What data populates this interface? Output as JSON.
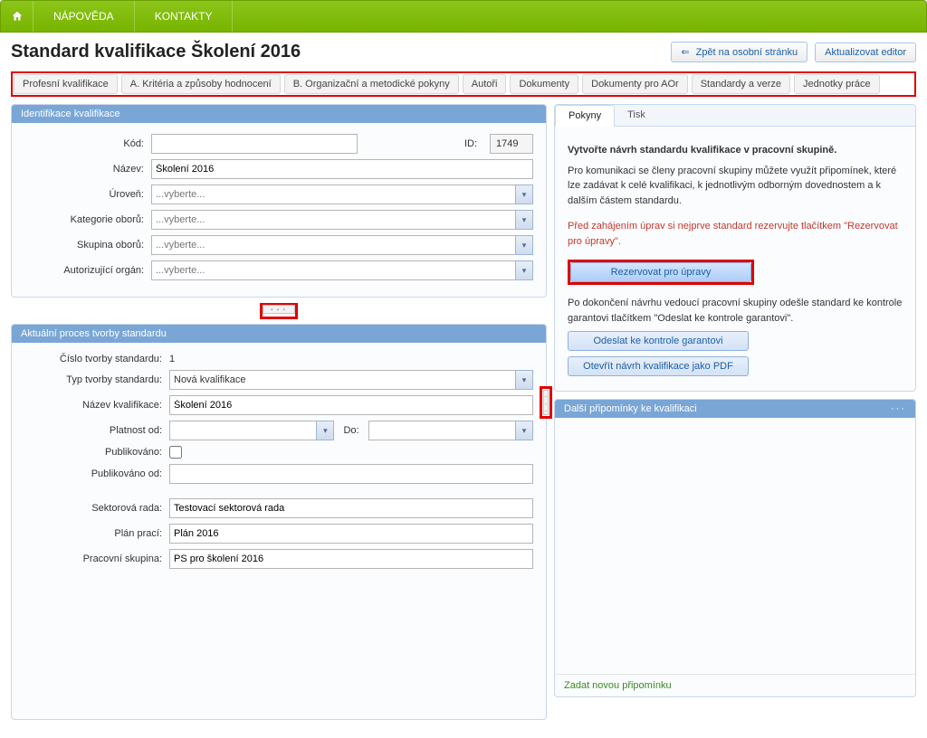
{
  "nav": {
    "help": "NÁPOVĚDA",
    "contacts": "KONTAKTY"
  },
  "header": {
    "title": "Standard kvalifikace Školení 2016",
    "back_btn": "Zpět na osobní stránku",
    "update_btn": "Aktualizovat editor"
  },
  "tabs": [
    "Profesní kvalifikace",
    "A. Kritéria a způsoby hodnocení",
    "B. Organizační a metodické pokyny",
    "Autoři",
    "Dokumenty",
    "Dokumenty pro AOr",
    "Standardy a verze",
    "Jednotky práce"
  ],
  "ident": {
    "title": "Identifikace kvalifikace",
    "labels": {
      "kod": "Kód:",
      "id": "ID:",
      "nazev": "Název:",
      "uroven": "Úroveň:",
      "kategorie": "Kategorie oborů:",
      "skupina": "Skupina oborů:",
      "autorg": "Autorizující orgán:"
    },
    "values": {
      "kod": "",
      "id": "1749",
      "nazev": "Školení 2016",
      "uroven": "...vyberte...",
      "kategorie": "...vyberte...",
      "skupina": "...vyberte...",
      "autorg": "...vyberte..."
    }
  },
  "process": {
    "title": "Aktuální proces tvorby standardu",
    "labels": {
      "cislo": "Číslo tvorby standardu:",
      "typ": "Typ tvorby standardu:",
      "nazev_kval": "Název kvalifikace:",
      "platnost_od": "Platnost od:",
      "do": "Do:",
      "publikovano": "Publikováno:",
      "publikovano_od": "Publikováno od:",
      "sektor": "Sektorová rada:",
      "plan": "Plán prací:",
      "skupina": "Pracovní skupina:"
    },
    "values": {
      "cislo": "1",
      "typ": "Nová kvalifikace",
      "nazev_kval": "Školení 2016",
      "platnost_od": "",
      "do": "",
      "publikovano": false,
      "publikovano_od": "",
      "sektor": "Testovací sektorová rada",
      "plan": "Plán 2016",
      "skupina": "PS pro školení 2016"
    }
  },
  "side": {
    "tabs": {
      "pokyny": "Pokyny",
      "tisk": "Tisk"
    },
    "intro_bold": "Vytvořte návrh standardu kvalifikace v pracovní skupině.",
    "intro_text": "Pro komunikaci se členy pracovní skupiny můžete využít připomínek, které lze zadávat k celé kvalifikaci, k jednotlivým odborným dovednostem a k dalším částem standardu.",
    "warn": "Před zahájením úprav si nejprve standard rezervujte tlačítkem \"Rezervovat pro úpravy\".",
    "btn_reserve": "Rezervovat pro úpravy",
    "after_text": "Po dokončení návrhu vedoucí pracovní skupiny odešle standard ke kontrole garantovi tlačítkem \"Odeslat ke kontrole garantovi\".",
    "btn_send": "Odeslat ke kontrole garantovi",
    "btn_pdf": "Otevřít návrh kvalifikace jako PDF",
    "comments_title": "Další připomínky ke kvalifikaci",
    "new_comment": "Zadat novou připomínku"
  }
}
